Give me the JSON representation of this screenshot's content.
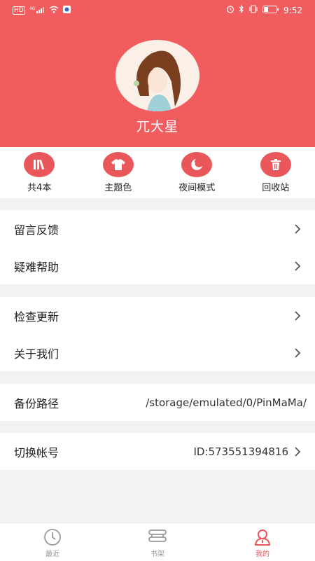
{
  "status": {
    "time": "9:52",
    "hd": "HD",
    "sig": "4G"
  },
  "profile": {
    "username": "兀大星"
  },
  "quick_actions": [
    {
      "label": "共4本",
      "icon": "books-icon"
    },
    {
      "label": "主题色",
      "icon": "tshirt-icon"
    },
    {
      "label": "夜间模式",
      "icon": "moon-icon"
    },
    {
      "label": "回收站",
      "icon": "trash-icon"
    }
  ],
  "menu": {
    "feedback": "留言反馈",
    "help": "疑难帮助",
    "update": "检查更新",
    "about": "关于我们",
    "backup_label": "备份路径",
    "backup_value": "/storage/emulated/0/PinMaMa/",
    "switch_label": "切换帐号",
    "switch_value": "ID:573551394816"
  },
  "nav": [
    {
      "label": "最近"
    },
    {
      "label": "书架"
    },
    {
      "label": "我的",
      "active": true
    }
  ],
  "colors": {
    "accent": "#f15d5e",
    "icon_bg": "#e9575a"
  }
}
